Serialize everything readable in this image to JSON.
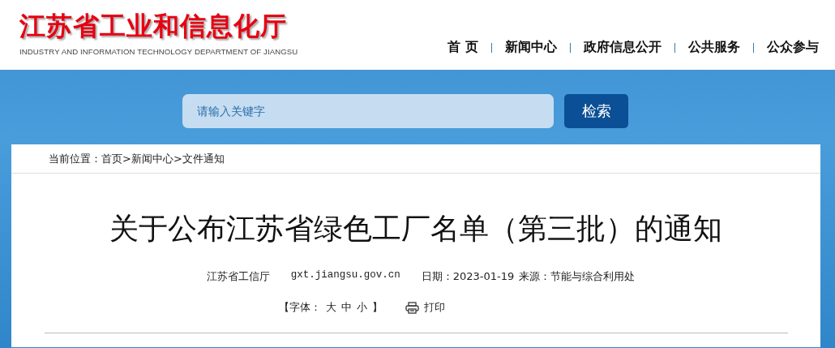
{
  "header": {
    "logo_title": "江苏省工业和信息化厅",
    "logo_subtitle": "INDUSTRY AND INFORMATION TECHNOLOGY DEPARTMENT OF JIANGSU"
  },
  "nav": [
    {
      "label": "首 页"
    },
    {
      "label": "新闻中心"
    },
    {
      "label": "政府信息公开"
    },
    {
      "label": "公共服务"
    },
    {
      "label": "公众参与"
    }
  ],
  "search": {
    "placeholder": "请输入关键字",
    "button": "检索"
  },
  "breadcrumb": "当前位置：首页>新闻中心>文件通知",
  "article": {
    "title": "关于公布江苏省绿色工厂名单（第三批）的通知",
    "publisher": "江苏省工信厅",
    "site": "gxt.jiangsu.gov.cn",
    "date": "日期：2023-01-19",
    "source": "来源：节能与综合利用处",
    "font_size": {
      "open": "【字体：",
      "options": [
        {
          "label": "大"
        },
        {
          "label": "中"
        },
        {
          "label": "小"
        }
      ],
      "close": "】"
    },
    "print": "打印"
  }
}
